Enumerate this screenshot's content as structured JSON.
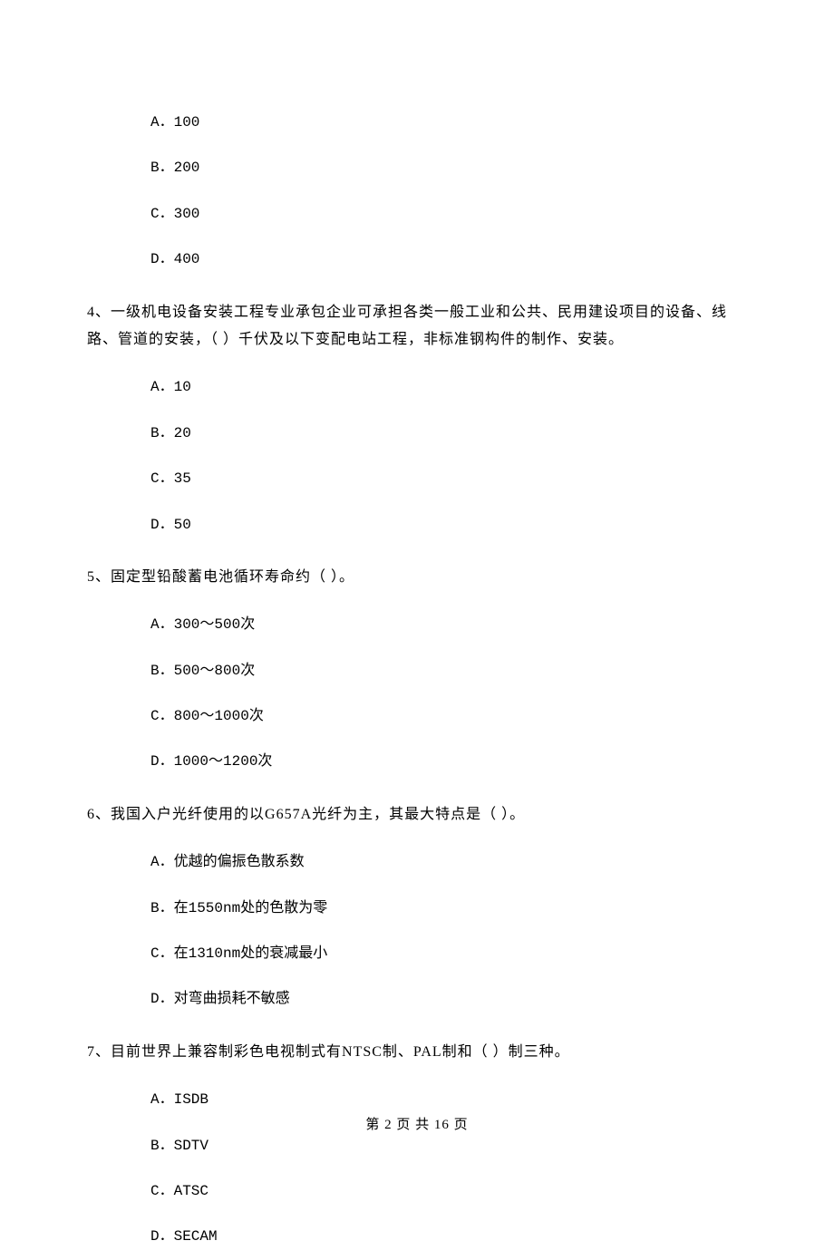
{
  "part_a_options": [
    "A．100",
    "B．200",
    "C．300",
    "D．400"
  ],
  "q4": {
    "number": "4、",
    "text": "一级机电设备安装工程专业承包企业可承担各类一般工业和公共、民用建设项目的设备、线路、管道的安装，（    ）千伏及以下变配电站工程，非标准钢构件的制作、安装。",
    "options": [
      "A．10",
      "B．20",
      "C．35",
      "D．50"
    ]
  },
  "q5": {
    "number": "5、",
    "text": "固定型铅酸蓄电池循环寿命约（    ）。",
    "options": [
      "A．300～500次",
      "B．500～800次",
      "C．800～1000次",
      "D．1000～1200次"
    ]
  },
  "q6": {
    "number": "6、",
    "text": "我国入户光纤使用的以G657A光纤为主，其最大特点是（    ）。",
    "options": [
      "A．优越的偏振色散系数",
      "B．在1550nm处的色散为零",
      "C．在1310nm处的衰减最小",
      "D．对弯曲损耗不敏感"
    ]
  },
  "q7": {
    "number": "7、",
    "text": "目前世界上兼容制彩色电视制式有NTSC制、PAL制和（    ）制三种。",
    "options": [
      "A．ISDB",
      "B．SDTV",
      "C．ATSC",
      "D．SECAM"
    ]
  },
  "footer": "第 2 页 共 16 页"
}
